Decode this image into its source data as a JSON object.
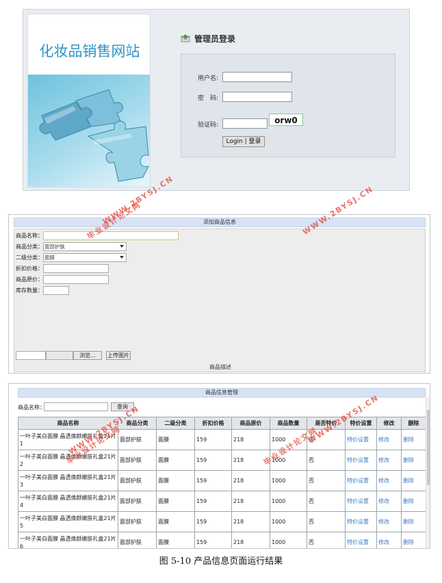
{
  "login": {
    "site_title": "化妆品销售网站",
    "heading": "管理员登录",
    "username_label": "用户名:",
    "password_label": "密　码:",
    "captcha_label": "验证码:",
    "captcha_text": "orw0",
    "login_button": "Login | 登录"
  },
  "add_product": {
    "title": "添加商品信息",
    "fields": {
      "name_label": "商品名称：",
      "category_label": "商品分类：",
      "category_value": "面部护肤",
      "subcategory_label": "二级分类：",
      "subcategory_value": "面膜",
      "discount_label": "折扣价格：",
      "original_label": "商品原价：",
      "stock_label": "库存数量："
    },
    "browse_button": "浏览...",
    "upload_button": "上传图片",
    "description_label": "商品描述"
  },
  "manage": {
    "title": "商品信息管理",
    "search_label": "商品名称：",
    "search_button": "查询",
    "columns": [
      "商品名称",
      "商品分类",
      "二级分类",
      "折扣价格",
      "商品原价",
      "商品数量",
      "是否特价",
      "特价设置",
      "修改",
      "删除"
    ],
    "rows": [
      {
        "name": "一叶子美白面膜 晶透焕颜嫩肤礼盒21片1",
        "category": "面部护肤",
        "sub": "面膜",
        "discount": "159",
        "original": "218",
        "qty": "1000",
        "special": "否",
        "set_special": "特价设置",
        "edit": "修改",
        "delete": "删除"
      },
      {
        "name": "一叶子美白面膜 晶透焕颜嫩肤礼盒21片2",
        "category": "面部护肤",
        "sub": "面膜",
        "discount": "159",
        "original": "218",
        "qty": "1000",
        "special": "否",
        "set_special": "特价设置",
        "edit": "修改",
        "delete": "删除"
      },
      {
        "name": "一叶子美白面膜 晶透焕颜嫩肤礼盒21片3",
        "category": "面部护肤",
        "sub": "面膜",
        "discount": "159",
        "original": "218",
        "qty": "1000",
        "special": "否",
        "set_special": "特价设置",
        "edit": "修改",
        "delete": "删除"
      },
      {
        "name": "一叶子美白面膜 晶透焕颜嫩肤礼盒21片4",
        "category": "面部护肤",
        "sub": "面膜",
        "discount": "159",
        "original": "218",
        "qty": "1000",
        "special": "否",
        "set_special": "特价设置",
        "edit": "修改",
        "delete": "删除"
      },
      {
        "name": "一叶子美白面膜 晶透焕颜嫩肤礼盒21片5",
        "category": "面部护肤",
        "sub": "面膜",
        "discount": "159",
        "original": "218",
        "qty": "1000",
        "special": "否",
        "set_special": "特价设置",
        "edit": "修改",
        "delete": "删除"
      },
      {
        "name": "一叶子美白面膜 晶透焕颜嫩肤礼盒21片6",
        "category": "面部护肤",
        "sub": "面膜",
        "discount": "159",
        "original": "218",
        "qty": "1000",
        "special": "否",
        "set_special": "特价设置",
        "edit": "修改",
        "delete": "删除"
      }
    ]
  },
  "caption": "图 5-10  产品信息页面运行结果",
  "watermarks": {
    "url": "WWW.2BYSJ.CN",
    "cn": "毕业设计论文网"
  },
  "colors": {
    "watermark": "#e14637",
    "title_bar": "#d7e3f4",
    "link": "#3d7bbf",
    "site_title": "#2d95c7"
  }
}
